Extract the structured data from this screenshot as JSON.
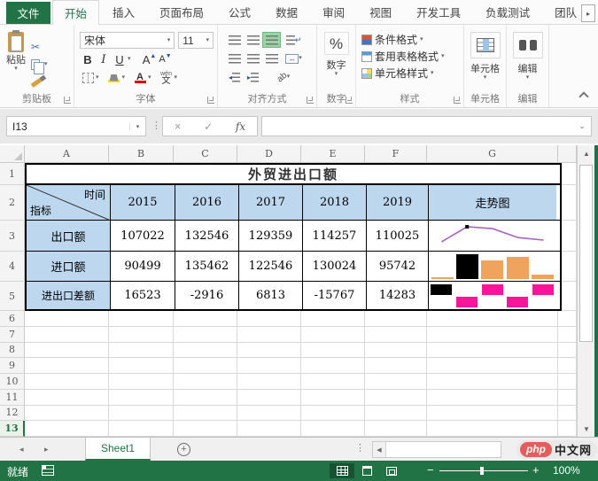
{
  "ribbon": {
    "tabs": [
      "文件",
      "开始",
      "插入",
      "页面布局",
      "公式",
      "数据",
      "审阅",
      "视图",
      "开发工具",
      "负载测试",
      "团队"
    ],
    "groups": {
      "clipboard": "剪贴板",
      "font": "字体",
      "alignment": "对齐方式",
      "number": "数字",
      "styles": "样式",
      "cells": "单元格",
      "editing": "编辑"
    },
    "buttons": {
      "paste": "粘贴",
      "bold": "B",
      "italic": "I",
      "underline": "U",
      "grow_font": "A",
      "shrink_font": "A",
      "font_color": "A",
      "phonetic_top": "wén",
      "phonetic_bottom": "文",
      "percent": "%",
      "number_label": "数字",
      "conditional_formatting": "条件格式",
      "format_as_table": "套用表格格式",
      "cell_styles": "单元格样式",
      "cells_label": "单元格",
      "editing_label": "编辑"
    },
    "font_name": "宋体",
    "font_size": "11"
  },
  "formula_bar": {
    "name_box": "I13",
    "cancel": "×",
    "enter": "✓",
    "fx": "fx",
    "value": ""
  },
  "sheet": {
    "columns": [
      "A",
      "B",
      "C",
      "D",
      "E",
      "F",
      "G"
    ],
    "rows": [
      "1",
      "2",
      "3",
      "4",
      "5",
      "6",
      "7",
      "8",
      "9",
      "10",
      "11",
      "12",
      "13"
    ],
    "active_row": "13",
    "title": "外贸进出口额",
    "diag": {
      "top": "时间",
      "bottom": "指标"
    },
    "years": [
      "2015",
      "2016",
      "2017",
      "2018",
      "2019"
    ],
    "trend_header": "走势图",
    "data_rows": [
      {
        "label": "出口额",
        "values": [
          "107022",
          "132546",
          "129359",
          "114257",
          "110025"
        ]
      },
      {
        "label": "进口额",
        "values": [
          "90499",
          "135462",
          "122546",
          "130024",
          "95742"
        ]
      },
      {
        "label": "进出口差额",
        "values": [
          "16523",
          "-2916",
          "6813",
          "-15767",
          "14283"
        ]
      }
    ]
  },
  "chart_data": [
    {
      "type": "line",
      "title": "出口额走势图",
      "x": [
        "2015",
        "2016",
        "2017",
        "2018",
        "2019"
      ],
      "values": [
        107022,
        132546,
        129359,
        114257,
        110025
      ],
      "color": "#a365c2",
      "high_point_color": "#000000",
      "high_point_marker": true
    },
    {
      "type": "bar",
      "title": "进口额走势图",
      "x": [
        "2015",
        "2016",
        "2017",
        "2018",
        "2019"
      ],
      "values": [
        90499,
        135462,
        122546,
        130024,
        95742
      ],
      "color": "#efa35d",
      "high_point_color": "#000000"
    },
    {
      "type": "winloss",
      "title": "进出口差额走势图",
      "x": [
        "2015",
        "2016",
        "2017",
        "2018",
        "2019"
      ],
      "values": [
        16523,
        -2916,
        6813,
        -15767,
        14283
      ],
      "color": "#f7169a",
      "high_point_color": "#000000"
    }
  ],
  "tabs_bar": {
    "sheet_name": "Sheet1"
  },
  "status_bar": {
    "ready": "就绪",
    "zoom": "100%"
  },
  "watermark": {
    "logo": "php",
    "text": "中文网"
  },
  "icons": {
    "dropdown": "▾",
    "up": "▲",
    "down": "▼",
    "left": "◀",
    "right": "▶",
    "nav_left": "◂",
    "nav_right": "▸",
    "dots": "⋮",
    "scissors": "✂",
    "expand": "⌄",
    "minus": "−",
    "plus": "+",
    "wrap_arrow": "↵",
    "merge_arrow": "↔",
    "indent_left": "◂",
    "indent_right": "▸",
    "orientation": "ab"
  },
  "colors": {
    "accent_green": "#217346",
    "header_fill_blue": "#bdd7ee",
    "gridline": "#d8d8d8",
    "sparkline_purple": "#a365c2",
    "sparkline_orange": "#efa35d",
    "sparkline_pink": "#f7169a",
    "high_point_black": "#000000",
    "watermark_red": "#e45c5c"
  }
}
